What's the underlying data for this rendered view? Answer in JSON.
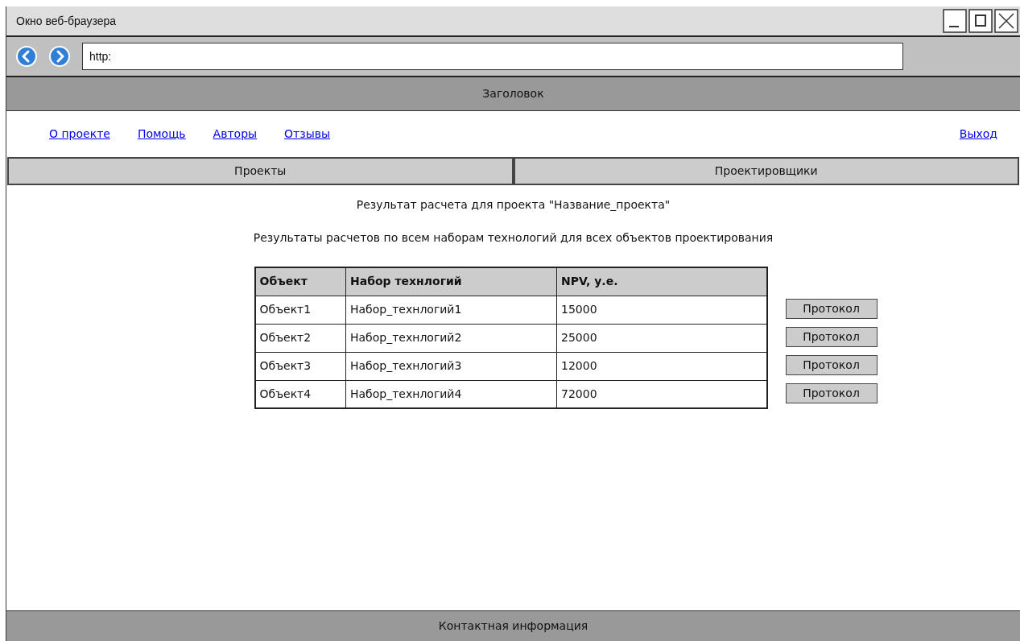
{
  "window": {
    "title": "Окно веб-браузера"
  },
  "address_bar": {
    "value": "http:"
  },
  "header": {
    "title": "Заголовок"
  },
  "nav_links": [
    {
      "label": "О проекте"
    },
    {
      "label": "Помощь"
    },
    {
      "label": "Авторы"
    },
    {
      "label": "Отзывы"
    }
  ],
  "logout_link": "Выход",
  "tabs": [
    {
      "label": "Проекты"
    },
    {
      "label": "Проектировщики"
    }
  ],
  "page_title": "Результат расчета для проекта \"Название_проекта\"",
  "subtitle": "Результаты расчетов по всем наборам технологий для всех объектов проектирования",
  "table": {
    "columns": [
      "Объект",
      "Набор технлогий",
      "NPV, у.е."
    ],
    "rows": [
      {
        "cells": [
          "Объект1",
          "Набор_технлогий1",
          "15000"
        ],
        "action": "Протокол"
      },
      {
        "cells": [
          "Объект2",
          "Набор_технлогий2",
          "25000"
        ],
        "action": "Протокол"
      },
      {
        "cells": [
          "Объект3",
          "Набор_технлогий3",
          "12000"
        ],
        "action": "Протокол"
      },
      {
        "cells": [
          "Объект4",
          "Набор_технлогий4",
          "72000"
        ],
        "action": "Протокол"
      }
    ]
  },
  "footer": {
    "text": "Контактная информация"
  }
}
